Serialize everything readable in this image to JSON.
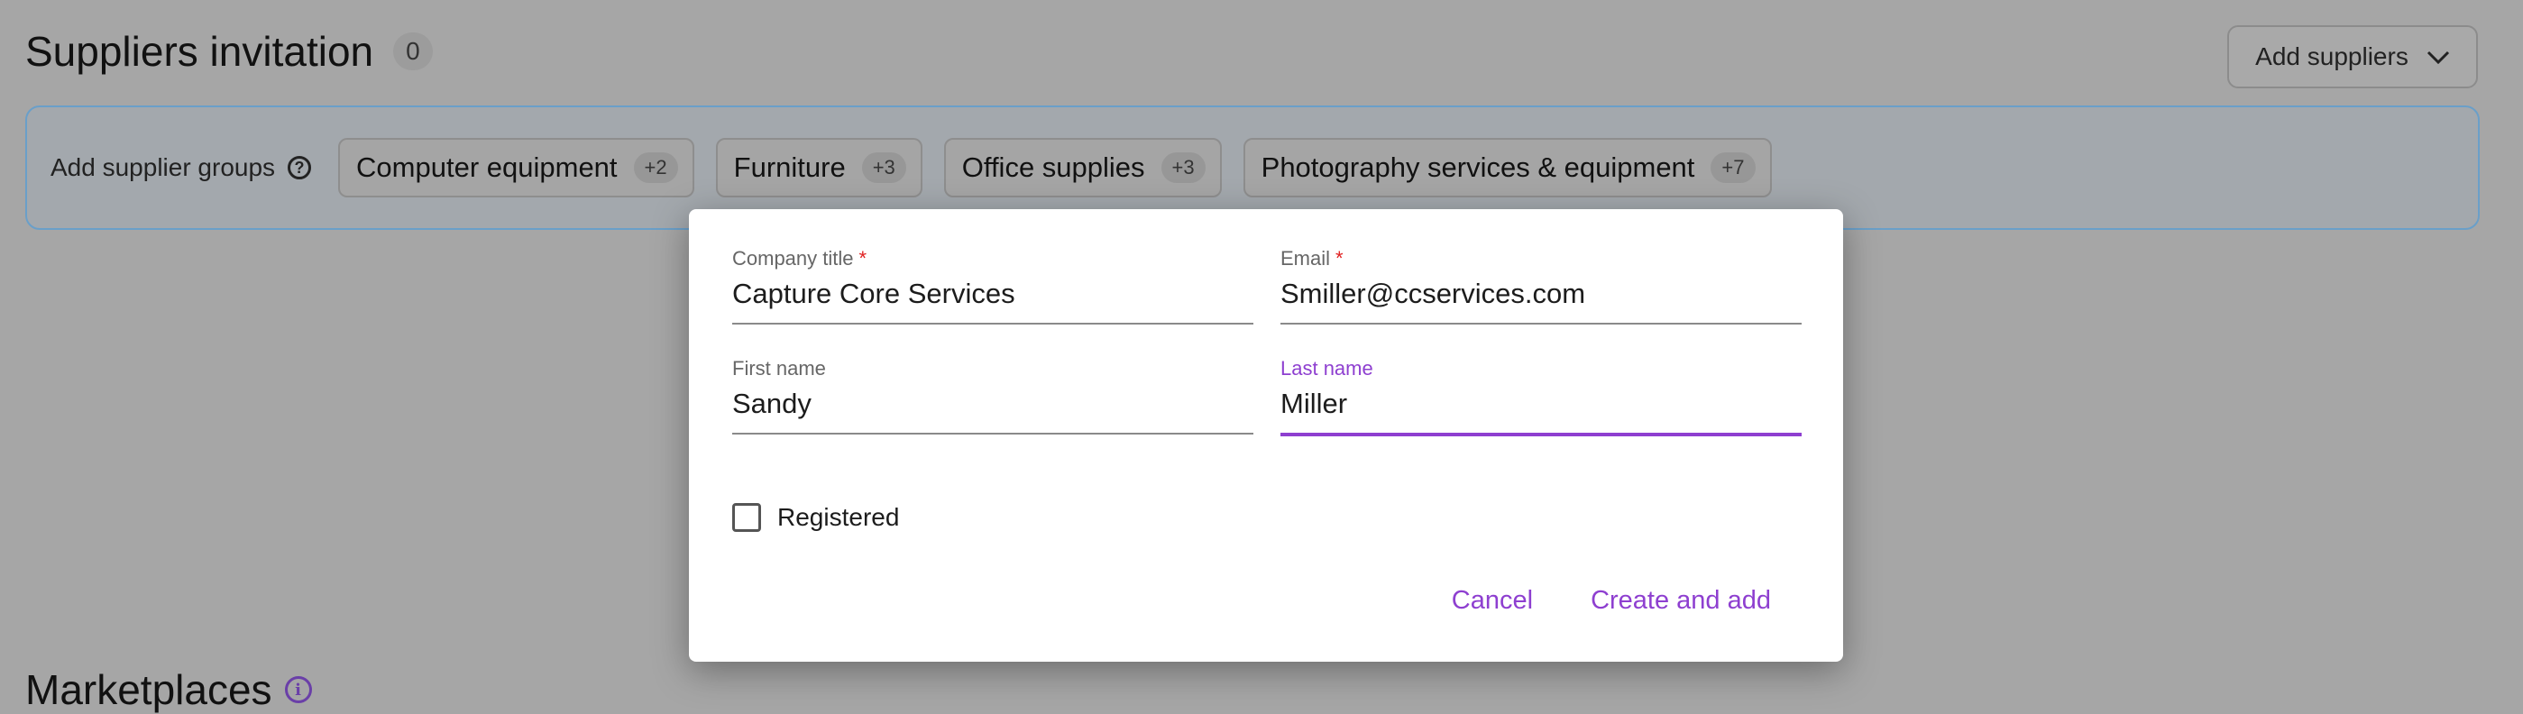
{
  "header": {
    "title": "Suppliers invitation",
    "count": "0",
    "add_suppliers_label": "Add suppliers",
    "add_suppliers_icon": "chevron-down-icon"
  },
  "groups": {
    "label": "Add supplier groups",
    "help_icon": "question-circle-icon",
    "chips": [
      {
        "name": "Computer equipment",
        "count": "+2"
      },
      {
        "name": "Furniture",
        "count": "+3"
      },
      {
        "name": "Office supplies",
        "count": "+3"
      },
      {
        "name": "Photography services & equipment",
        "count": "+7"
      }
    ]
  },
  "marketplaces": {
    "title": "Marketplaces",
    "info_icon": "info-circle-icon"
  },
  "modal": {
    "company_title": {
      "label": "Company title",
      "required_mark": "*",
      "value": "Capture Core Services"
    },
    "email": {
      "label": "Email",
      "required_mark": "*",
      "value": "Smiller@ccservices.com"
    },
    "first_name": {
      "label": "First name",
      "value": "Sandy"
    },
    "last_name": {
      "label": "Last name",
      "value": "Miller"
    },
    "registered_label": "Registered",
    "cancel_label": "Cancel",
    "create_label": "Create and add"
  },
  "colors": {
    "accent": "#8e3fd0",
    "required": "#e02020",
    "overlay_bg": "#a6a6a6"
  }
}
